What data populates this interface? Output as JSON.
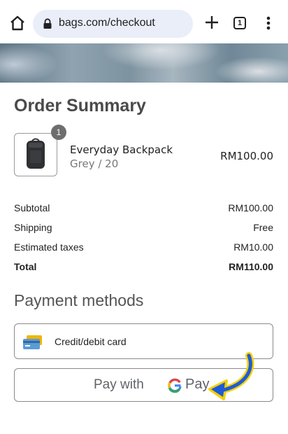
{
  "browser": {
    "url": "bags.com/checkout",
    "tab_count": "1",
    "icons": {
      "home": "home-icon",
      "lock": "lock-icon",
      "new_tab": "plus-icon",
      "tabs": "tabs-icon",
      "menu": "more-vert-icon"
    }
  },
  "order": {
    "title": "Order Summary",
    "item": {
      "quantity": "1",
      "name": "Everyday Backpack",
      "variant": "Grey / 20",
      "price": "RM100.00"
    },
    "summary": [
      {
        "label": "Subtotal",
        "value": "RM100.00"
      },
      {
        "label": "Shipping",
        "value": "Free"
      },
      {
        "label": "Estimated taxes",
        "value": "RM10.00"
      },
      {
        "label": "Total",
        "value": "RM110.00"
      }
    ]
  },
  "payment": {
    "title": "Payment methods",
    "card_label": "Credit/debit card",
    "gpay_prefix": "Pay with",
    "gpay_brand": "Pay"
  },
  "colors": {
    "arrow": "#1e5bd8",
    "arrow_outline": "#f5d000",
    "google_blue": "#4285f4",
    "google_red": "#ea4335",
    "google_yellow": "#fbbc05",
    "google_green": "#34a853"
  }
}
